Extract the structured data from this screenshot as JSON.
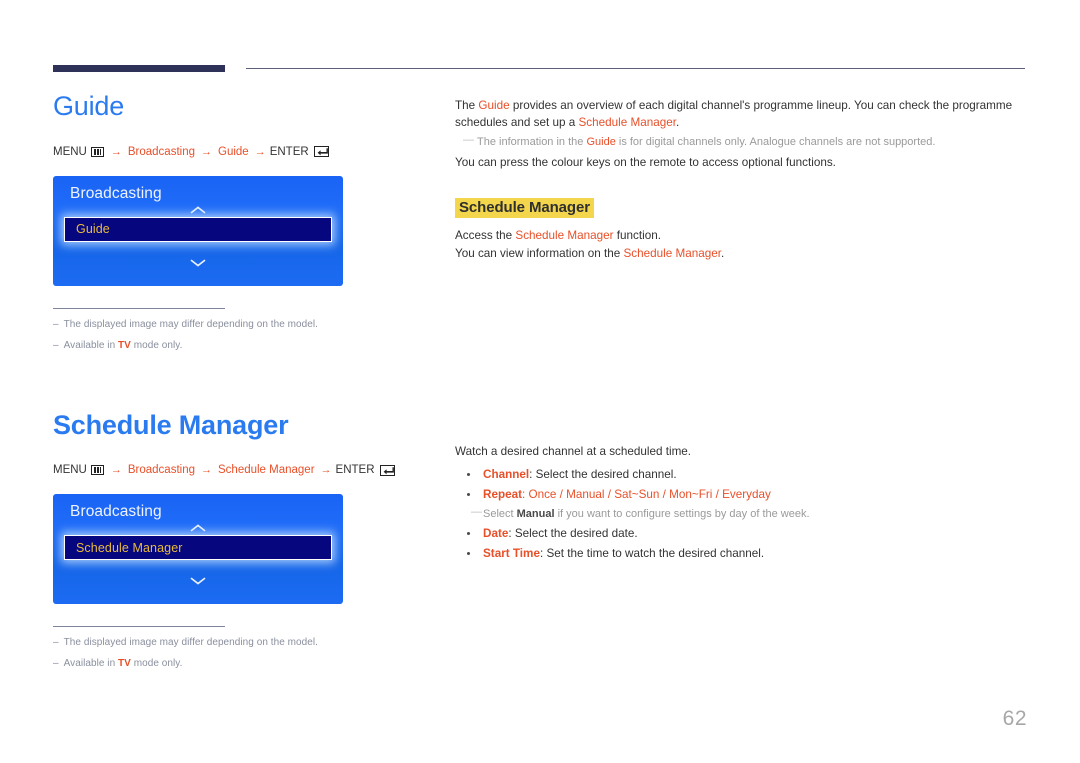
{
  "page": {
    "number": "62"
  },
  "sections": [
    {
      "id": "guide",
      "heading": "Guide",
      "menu_path": {
        "menu_label": "MENU",
        "menu_icon": "menu-grid-icon",
        "arrow": "→",
        "crumbs": [
          "Broadcasting",
          "Guide"
        ],
        "enter_label": "ENTER",
        "enter_icon": "enter-return-icon"
      },
      "tv_mock": {
        "title": "Broadcasting",
        "chevron_up_icon": "chevron-up-icon",
        "chevron_down_icon": "chevron-down-icon",
        "selected_item": "Guide"
      },
      "footnotes": [
        {
          "dash": "–",
          "text": "The displayed image may differ depending on the model."
        },
        {
          "dash": "–",
          "pre": "Available in ",
          "red": "TV",
          "post": " mode only."
        }
      ]
    },
    {
      "id": "schedule-manager",
      "heading": "Schedule Manager",
      "menu_path": {
        "menu_label": "MENU",
        "menu_icon": "menu-grid-icon",
        "arrow": "→",
        "crumbs": [
          "Broadcasting",
          "Schedule Manager"
        ],
        "enter_label": "ENTER",
        "enter_icon": "enter-return-icon"
      },
      "tv_mock": {
        "title": "Broadcasting",
        "chevron_up_icon": "chevron-up-icon",
        "chevron_down_icon": "chevron-down-icon",
        "selected_item": "Schedule Manager"
      },
      "footnotes": [
        {
          "dash": "–",
          "text": "The displayed image may differ depending on the model."
        },
        {
          "dash": "–",
          "pre": "Available in ",
          "red": "TV",
          "post": " mode only."
        }
      ]
    }
  ],
  "right": {
    "guide": {
      "para1_a": "The ",
      "para1_term": "Guide",
      "para1_b": " provides an overview of each digital channel's programme lineup. You can check the programme schedules and set up a ",
      "para1_term2": "Schedule Manager",
      "para1_c": ".",
      "note_a": "The information in the ",
      "note_term": "Guide",
      "note_b": " is for digital channels only. Analogue channels are not supported.",
      "para2": "You can press the colour keys on the remote to access optional functions."
    },
    "schedule_heading": "Schedule Manager",
    "schedule": {
      "line1_a": "Access the ",
      "line1_term": "Schedule Manager",
      "line1_b": " function.",
      "line2_a": "You can view information on the ",
      "line2_term": "Schedule Manager",
      "line2_b": "."
    },
    "watch": {
      "intro": "Watch a desired channel at a scheduled time.",
      "bullets": [
        {
          "key": "Channel",
          "sep": ": ",
          "text": "Select the desired channel."
        },
        {
          "key": "Repeat",
          "sep": ": ",
          "options": [
            "Once",
            "Manual",
            "Sat~Sun",
            "Mon~Fri",
            "Everyday"
          ],
          "option_sep": " / "
        },
        {
          "key": "Date",
          "sep": ": ",
          "text": "Select the desired date."
        },
        {
          "key": "Start Time",
          "sep": ": ",
          "text": "Set the time to watch the desired channel."
        }
      ],
      "repeat_note_a": "Select ",
      "repeat_note_term": "Manual",
      "repeat_note_b": " if you want to configure settings by day of the week."
    }
  },
  "colors": {
    "heading_blue": "#2b7bf0",
    "accent_orange": "#e8502a",
    "highlight_yellow": "#f3d64b",
    "rule_navy": "#2e3258",
    "tv_blue": "#1a63f5",
    "tv_selected_navy": "#06067e",
    "tv_selected_text": "#e8bb3c",
    "note_gray": "#8a8f9e"
  }
}
